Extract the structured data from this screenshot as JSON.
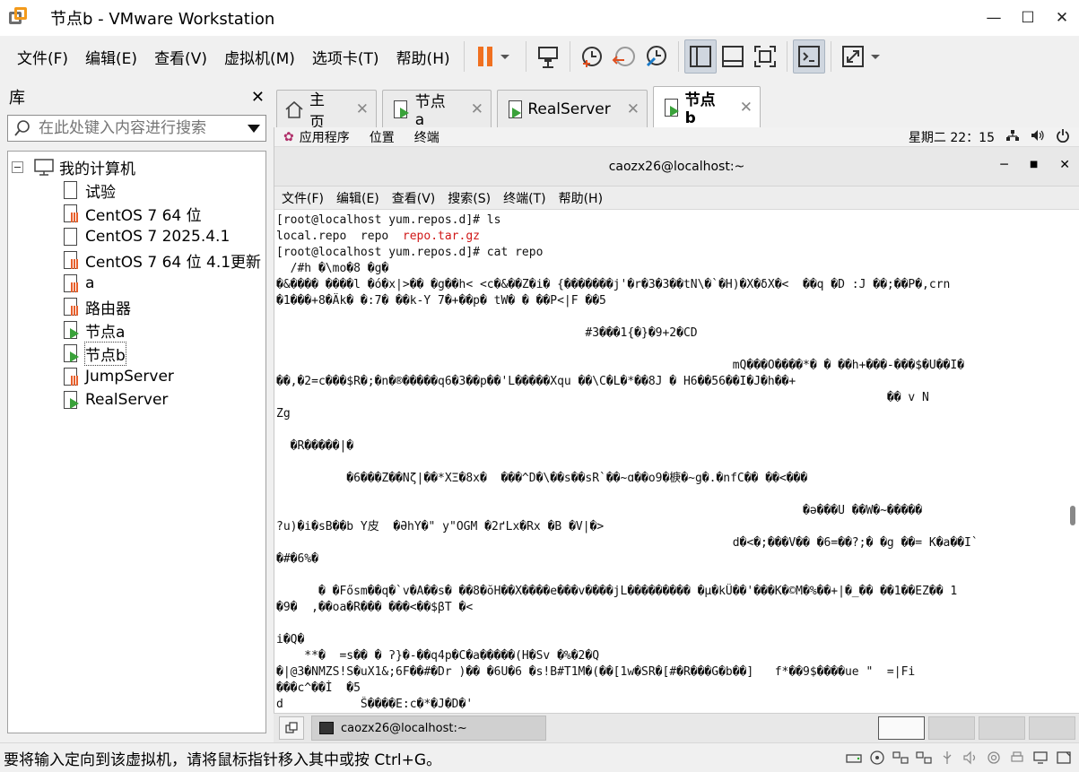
{
  "window": {
    "title": "节点b - VMware Workstation"
  },
  "menu": [
    "文件(F)",
    "编辑(E)",
    "查看(V)",
    "虚拟机(M)",
    "选项卡(T)",
    "帮助(H)"
  ],
  "library": {
    "title": "库",
    "search_placeholder": "在此处键入内容进行搜索",
    "root": "我的计算机",
    "items": [
      {
        "label": "试验",
        "icon": "vm-doc-icon"
      },
      {
        "label": "CentOS 7 64 位",
        "icon": "vm-suspended-icon"
      },
      {
        "label": "CentOS 7 2025.4.1",
        "icon": "vm-off-icon"
      },
      {
        "label": "CentOS 7 64 位 4.1更新",
        "icon": "vm-suspended-icon"
      },
      {
        "label": "a",
        "icon": "vm-suspended-icon"
      },
      {
        "label": "路由器",
        "icon": "vm-suspended-icon"
      },
      {
        "label": "节点a",
        "icon": "vm-running-icon"
      },
      {
        "label": "节点b",
        "icon": "vm-running-icon"
      },
      {
        "label": "JumpServer",
        "icon": "vm-suspended-icon"
      },
      {
        "label": "RealServer",
        "icon": "vm-running-icon"
      }
    ]
  },
  "tabs": [
    {
      "label": "主页"
    },
    {
      "label": "节点a"
    },
    {
      "label": "RealServer"
    },
    {
      "label": "节点b"
    }
  ],
  "gnome": {
    "apps": "应用程序",
    "places": "位置",
    "terminal": "终端",
    "clock": "星期二 22：15"
  },
  "terminal": {
    "title": "caozx26@localhost:~",
    "menu": [
      "文件(F)",
      "编辑(E)",
      "查看(V)",
      "搜索(S)",
      "终端(T)",
      "帮助(H)"
    ],
    "lines": [
      "[root@localhost yum.repos.d]# ls",
      "",
      "[root@localhost yum.repos.d]# cat repo",
      "  /#h �\\mo�8 �g�",
      "�&���� ����l �ó�x|>�� �g��h< <c�&��Z�i� {�������j'�r�3�3��tN\\�`�H)�X�δX�<  ��q �D :J ��;��P�,crn",
      "�1���+8�Äk� �:7� ��k-Y 7�+��p� tW� � ��P<|F ��5",
      "",
      "                                            #3���1{�}�9+2�CD",
      "",
      "                                                                 mQ���O����*� � ��h+���-���$�U��I�",
      "��,�2=c���$R�;�n�®�����q6�3��p��'L�����Xqu ��\\C�L�*��8J � H6��56��I�J�h��+",
      "                                                                                       �� v N",
      "Zg",
      "",
      "  �R�����|�",
      "",
      "          �6���Z��Nζ|��*XΞ�8x�  ���^D�\\��s��sR`��~ɑ��o9�椩�~g�.�nfC�� ��<���",
      "",
      "                                                                           �ǝ���U ��W�~�����",
      "?u)�i�sB��b Y皮  �Ə­hY�\" y\"OGM �2ґLx�Rx �B �V|�>",
      "                                                                 d�<�;���V�� �6=��?;� �g ��= K�a��I`",
      "�#�6%�",
      "",
      "      � �Fő­sm��q�`v�A��s� ��8�ŏH��X����e���v����jL��������� �µ�kÜ��'���K�©M�%��+|�_�� ��1��EZ�� 1",
      "�9�  ,��oa�R��� ���<��$βT �<",
      "",
      "i�Q�",
      "    **�  =s�� � ʔ}�-��q4p�C�a�����(H�Sv �%�2�Q",
      "�|@3�NMZS!S�uX1&;6F��#�Dr )�� �6U�6 �s!B#T1M�(��[1w�SR�[#�R���G�b��]   f*��9$����ue \"  =|Fi",
      "���c^��Ì  �5",
      "d           Ŝ����E:c�*�J�D�'"
    ],
    "ls_output": {
      "a": "local.repo  repo  ",
      "b": "repo.tar.gz"
    }
  },
  "taskbar": {
    "item": "caozx26@localhost:~"
  },
  "status": {
    "text": "要将输入定向到该虚拟机，请将鼠标指针移入其中或按 Ctrl+G。"
  },
  "colors": {
    "accent_orange": "#f39a1b",
    "running_green": "#3aa23a",
    "ls_archive_red": "#d01818"
  }
}
